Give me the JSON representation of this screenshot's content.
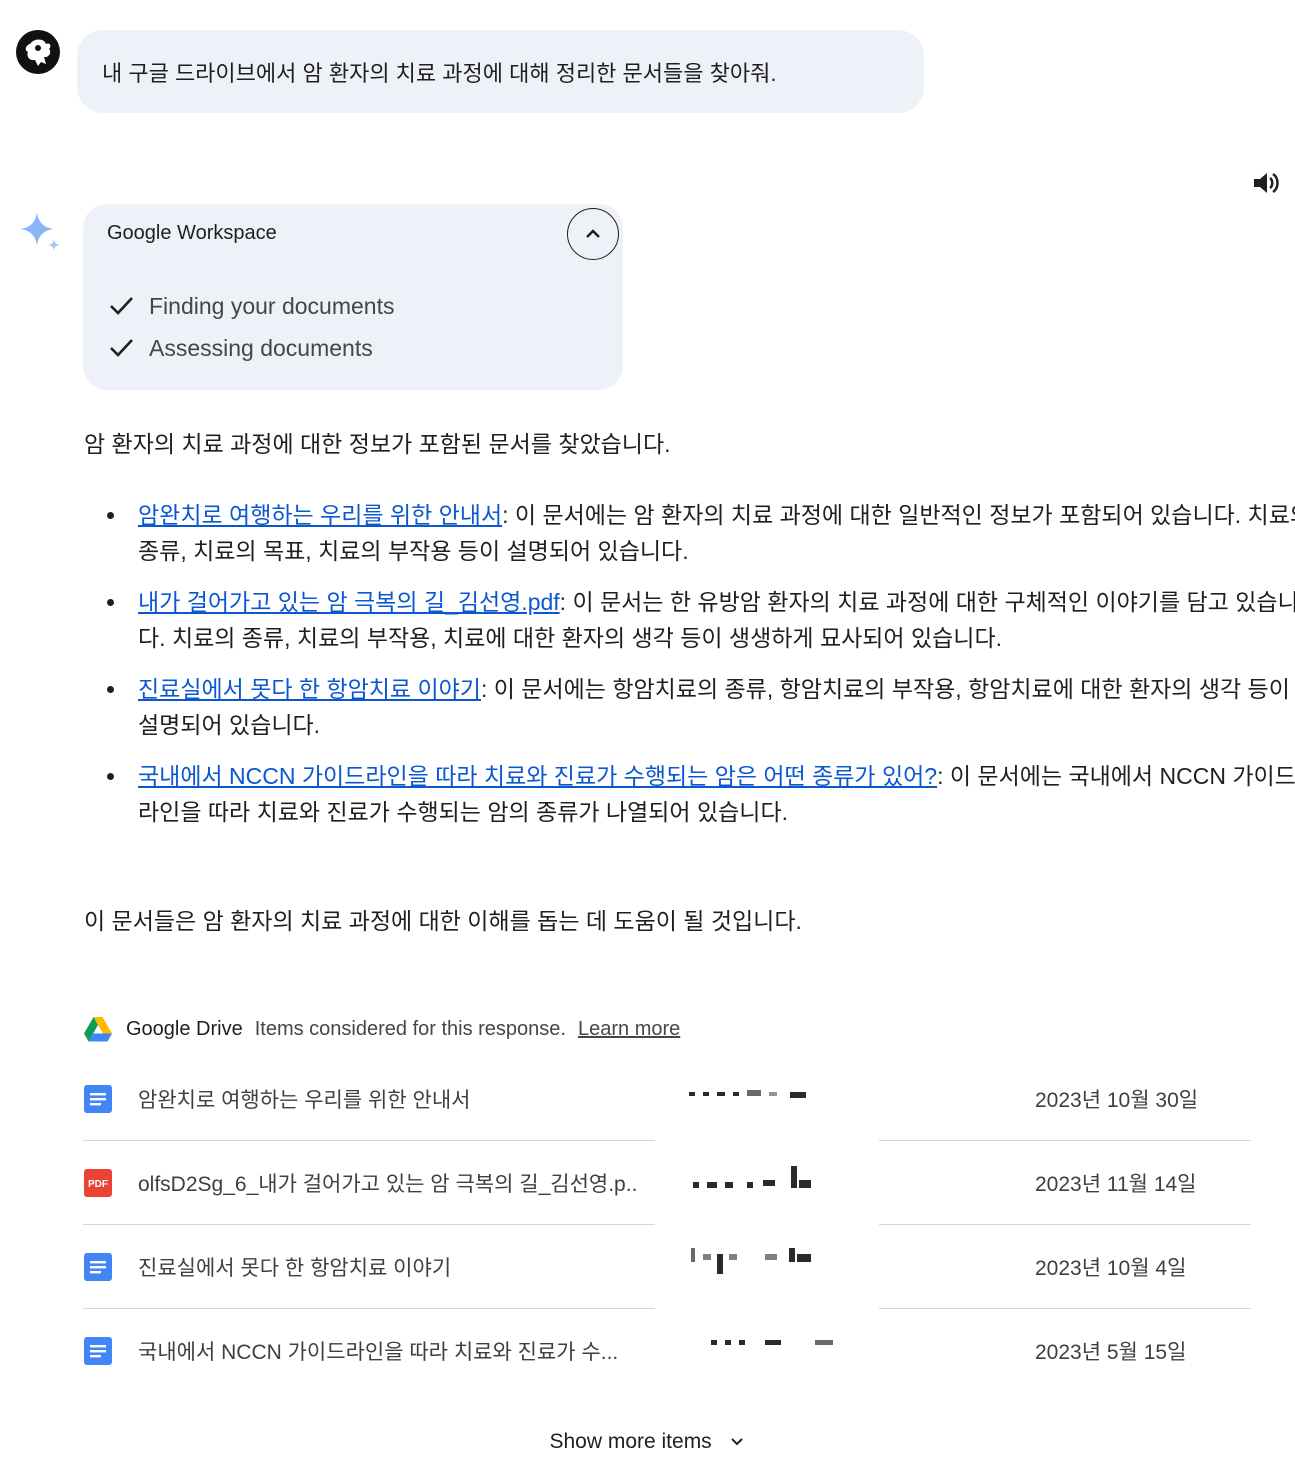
{
  "user_message": "내 구글 드라이브에서 암 환자의 치료 과정에 대해 정리한 문서들을 찾아줘.",
  "workspace": {
    "title": "Google Workspace",
    "steps": [
      {
        "label": "Finding your documents"
      },
      {
        "label": "Assessing documents"
      }
    ]
  },
  "response": {
    "intro": "암 환자의 치료 과정에 대한 정보가 포함된 문서를 찾았습니다.",
    "items": [
      {
        "link": "암완치로 여행하는 우리를 위한 안내서",
        "desc": ": 이 문서에는 암 환자의 치료 과정에 대한 일반적인 정보가 포함되어 있습니다. 치료의 종류, 치료의 목표, 치료의 부작용 등이 설명되어 있습니다."
      },
      {
        "link": "내가 걸어가고 있는 암 극복의 길_김선영.pdf",
        "desc": ": 이 문서는 한 유방암 환자의 치료 과정에 대한 구체적인 이야기를 담고 있습니다. 치료의 종류, 치료의 부작용, 치료에 대한 환자의 생각 등이 생생하게 묘사되어 있습니다."
      },
      {
        "link": "진료실에서 못다 한 항암치료 이야기",
        "desc": ": 이 문서에는 항암치료의 종류, 항암치료의 부작용, 항암치료에 대한 환자의 생각 등이 설명되어 있습니다."
      },
      {
        "link": "국내에서 NCCN 가이드라인을 따라 치료와 진료가 수행되는 암은 어떤 종류가 있어?",
        "desc": ": 이 문서에는 국내에서 NCCN 가이드라인을 따라 치료와 진료가 수행되는 암의 종류가 나열되어 있습니다."
      }
    ],
    "outro": "이 문서들은 암 환자의 치료 과정에 대한 이해를 돕는 데 도움이 될 것입니다."
  },
  "drive": {
    "brand": "Google Drive",
    "note": "Items considered for this response.",
    "learn_more": "Learn more",
    "files": [
      {
        "type": "doc-icon",
        "name": "암완치로 여행하는 우리를 위한 안내서",
        "date": "2023년 10월 30일"
      },
      {
        "type": "pdf-icon",
        "name": "olfsD2Sg_6_내가 걸어가고 있는 암 극복의 길_김선영.p..",
        "date": "2023년 11월 14일",
        "badge": "PDF"
      },
      {
        "type": "doc-icon",
        "name": "진료실에서 못다 한 항암치료 이야기",
        "date": "2023년 10월 4일"
      },
      {
        "type": "doc-icon",
        "name": "국내에서 NCCN 가이드라인을 따라 치료와 진료가 수...",
        "date": "2023년 5월 15일"
      }
    ],
    "show_more": "Show more items"
  },
  "colors": {
    "link": "#0b57d0",
    "card_bg": "#eef1f7",
    "doc_blue": "#4285f4",
    "pdf_red": "#ea4335"
  }
}
